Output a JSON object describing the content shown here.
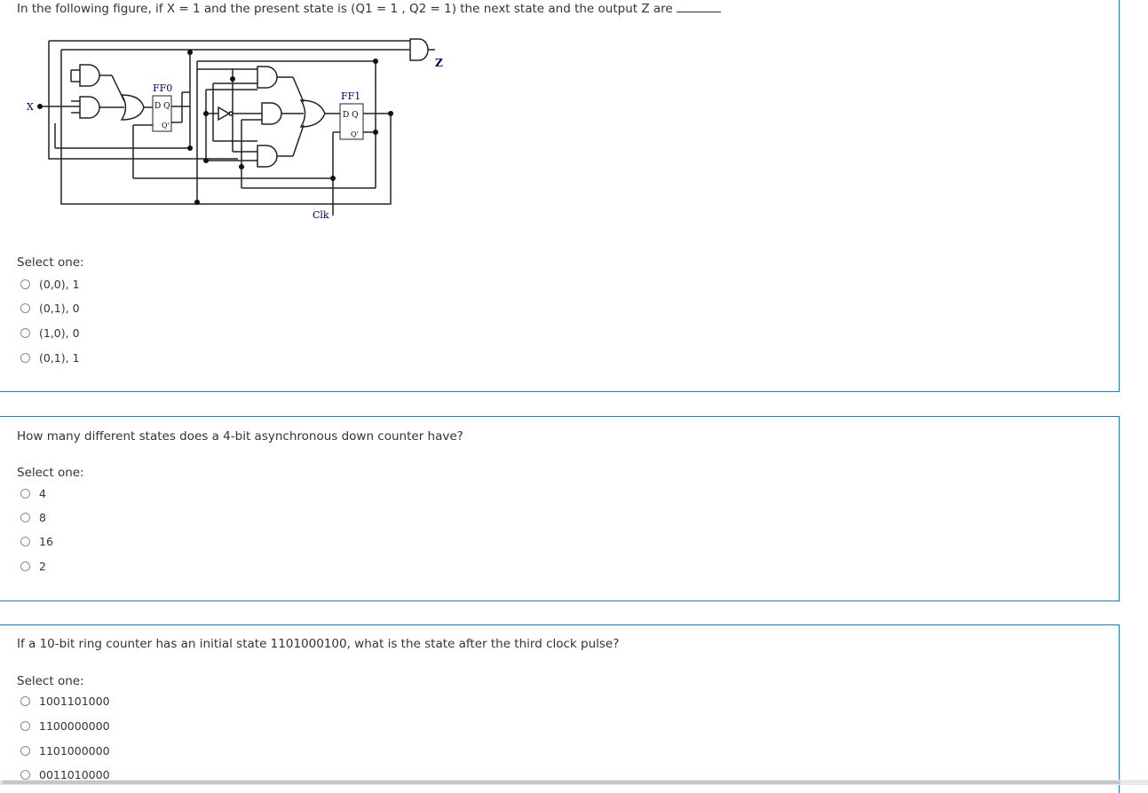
{
  "q1": {
    "text": "In the following figure, if X = 1 and the present state is (Q1 = 1 , Q2 = 1) the next state and the output Z are",
    "select_label": "Select one:",
    "options": [
      "(0,0), 1",
      "(0,1), 0",
      "(1,0), 0",
      "(0,1), 1"
    ],
    "figure": {
      "ff0_label": "FF0",
      "ff1_label": "FF1",
      "dq_label": "D Q",
      "qbar_label": "Q'",
      "x_label": "X",
      "z_label": "Z",
      "clk_label": "Clk"
    }
  },
  "q2": {
    "text": "How many different states does a 4-bit asynchronous down counter have?",
    "select_label": "Select one:",
    "options": [
      "4",
      "8",
      "16",
      "2"
    ]
  },
  "q3": {
    "text": "If a 10-bit ring counter has an initial state 1101000100, what is the state after the third clock pulse?",
    "select_label": "Select one:",
    "options": [
      "1001101000",
      "1100000000",
      "1101000000",
      "0011010000"
    ]
  }
}
